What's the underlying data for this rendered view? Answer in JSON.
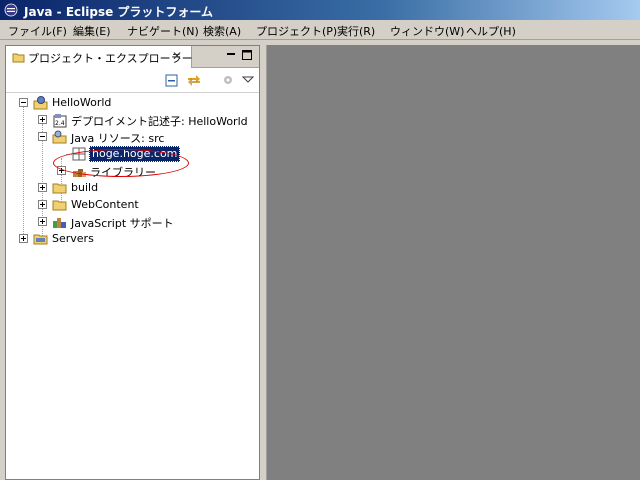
{
  "window": {
    "title": "Java - Eclipse プラットフォーム"
  },
  "menubar": {
    "items": [
      "ファイル(F)",
      "編集(E)",
      "ナビゲート(N)",
      "検索(A)",
      "プロジェクト(P)",
      "実行(R)",
      "ウィンドウ(W)",
      "ヘルプ(H)"
    ]
  },
  "view": {
    "tab_label": "プロジェクト・エクスプローラー",
    "close_glyph": "✕"
  },
  "tree": {
    "project": "HelloWorld",
    "deployment": "デプロイメント記述子: HelloWorld",
    "java_resources": "Java リソース: src",
    "package": "hoge.hoge.com",
    "libraries": "ライブラリー",
    "build": "build",
    "webcontent": "WebContent",
    "javascript": "JavaScript サポート",
    "servers": "Servers"
  },
  "colors": {
    "selection": "#0a246a",
    "annotation": "#e00000",
    "chrome": "#d4d0c8"
  }
}
